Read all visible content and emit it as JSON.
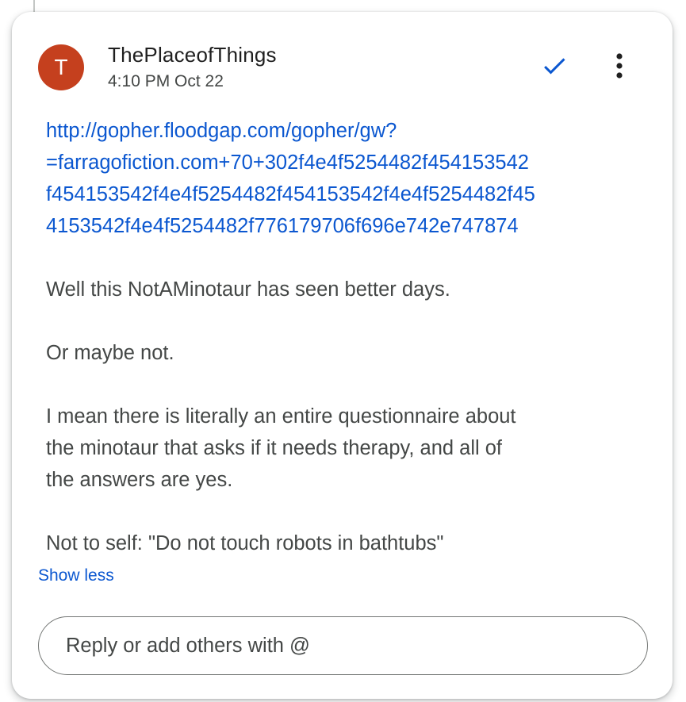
{
  "comment": {
    "avatar_letter": "T",
    "avatar_color": "#c5401e",
    "author": "ThePlaceofThings",
    "timestamp": "4:10 PM Oct 22",
    "resolve_icon": "checkmark-icon",
    "more_icon": "more-vert-icon",
    "link_lines": [
      "http://gopher.floodgap.com/gopher/gw?",
      "=farragofiction.com+70+302f4e4f5254482f454153542",
      "f454153542f4e4f5254482f454153542f4e4f5254482f45",
      "4153542f4e4f5254482f776179706f696e742e747874"
    ],
    "paragraphs": [
      [
        "Well this NotAMinotaur has seen better days."
      ],
      [
        "Or maybe not."
      ],
      [
        "I mean there is literally an entire questionnaire about",
        "the minotaur that asks if it needs therapy, and all of",
        "the answers are yes."
      ],
      [
        "Not to self: \"Do not touch robots in bathtubs\""
      ]
    ],
    "show_less_label": "Show less"
  },
  "reply": {
    "placeholder": "Reply or add others with @"
  },
  "colors": {
    "link": "#0b57d0",
    "text": "#444746",
    "accent_check": "#0b57d0"
  }
}
